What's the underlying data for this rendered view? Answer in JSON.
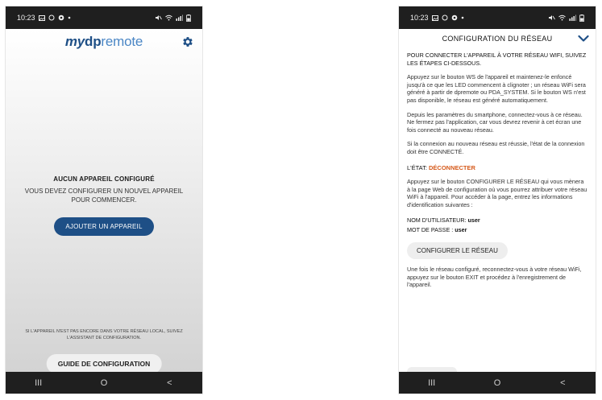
{
  "status_bar": {
    "time": "10:23"
  },
  "left_screen": {
    "logo": {
      "part1": "my",
      "part2": "dp",
      "part3": "remote"
    },
    "empty_title": "AUCUN APPAREIL CONFIGURÉ",
    "empty_subtitle": "VOUS DEVEZ CONFIGURER UN NOUVEL APPAREIL POUR COMMENCER.",
    "add_device_button": "AJOUTER UN APPAREIL",
    "hint_text": "SI L'APPAREIL N'EST PAS ENCORE DANS VOTRE RÉSEAU LOCAL, SUIVEZ L'ASSISTANT DE CONFIGURATION.",
    "setup_guide_button": "GUIDE DE CONFIGURATION"
  },
  "right_screen": {
    "title": "CONFIGURATION DU RÉSEAU",
    "intro": "POUR CONNECTER L'APPAREIL À VOTRE RÉSEAU WIFI, SUIVEZ LES ÉTAPES CI-DESSOUS.",
    "paragraph1": "Appuyez sur le bouton WS de l'appareil et maintenez-le enfoncé jusqu'à ce que les LED commencent à clignoter ; un réseau WiFi sera généré à partir de dpremote ou PDA_SYSTEM. Si le bouton WS n'est pas disponible, le réseau est généré automatiquement.",
    "paragraph2": "Depuis les paramètres du smartphone, connectez-vous à ce réseau. Ne fermez pas l'application, car vous devrez revenir à cet écran une fois connecté au nouveau réseau.",
    "paragraph3": "Si la connexion au nouveau réseau est réussie, l'état de la connexion doit être CONNECTÉ.",
    "state_label": "L'ÉTAT:",
    "state_value": "DÉCONNECTER",
    "paragraph4": "Appuyez sur le bouton CONFIGURER LE RÉSEAU qui vous mènera à la page Web de configuration où vous pourrez attribuer votre réseau WiFi à l'appareil. Pour accéder à la page, entrez les informations d'identification suivantes :",
    "username_label": "NOM D'UTILISATEUR:",
    "username_value": "user",
    "password_label": "MOT DE PASSE :",
    "password_value": "user",
    "configure_button": "CONFIGURER LE RÉSEAU",
    "paragraph5": "Une fois le réseau configuré, reconnectez-vous à votre réseau WiFi, appuyez sur le bouton EXIT et procédez à l'enregistrement de l'appareil."
  },
  "nav_bar": {
    "recents_glyph": "III",
    "home_glyph": "O",
    "back_glyph": "<"
  },
  "colors": {
    "brand_blue": "#1e4f86",
    "status_orange": "#d65a1b",
    "bar_dark": "#1f1f1f"
  }
}
